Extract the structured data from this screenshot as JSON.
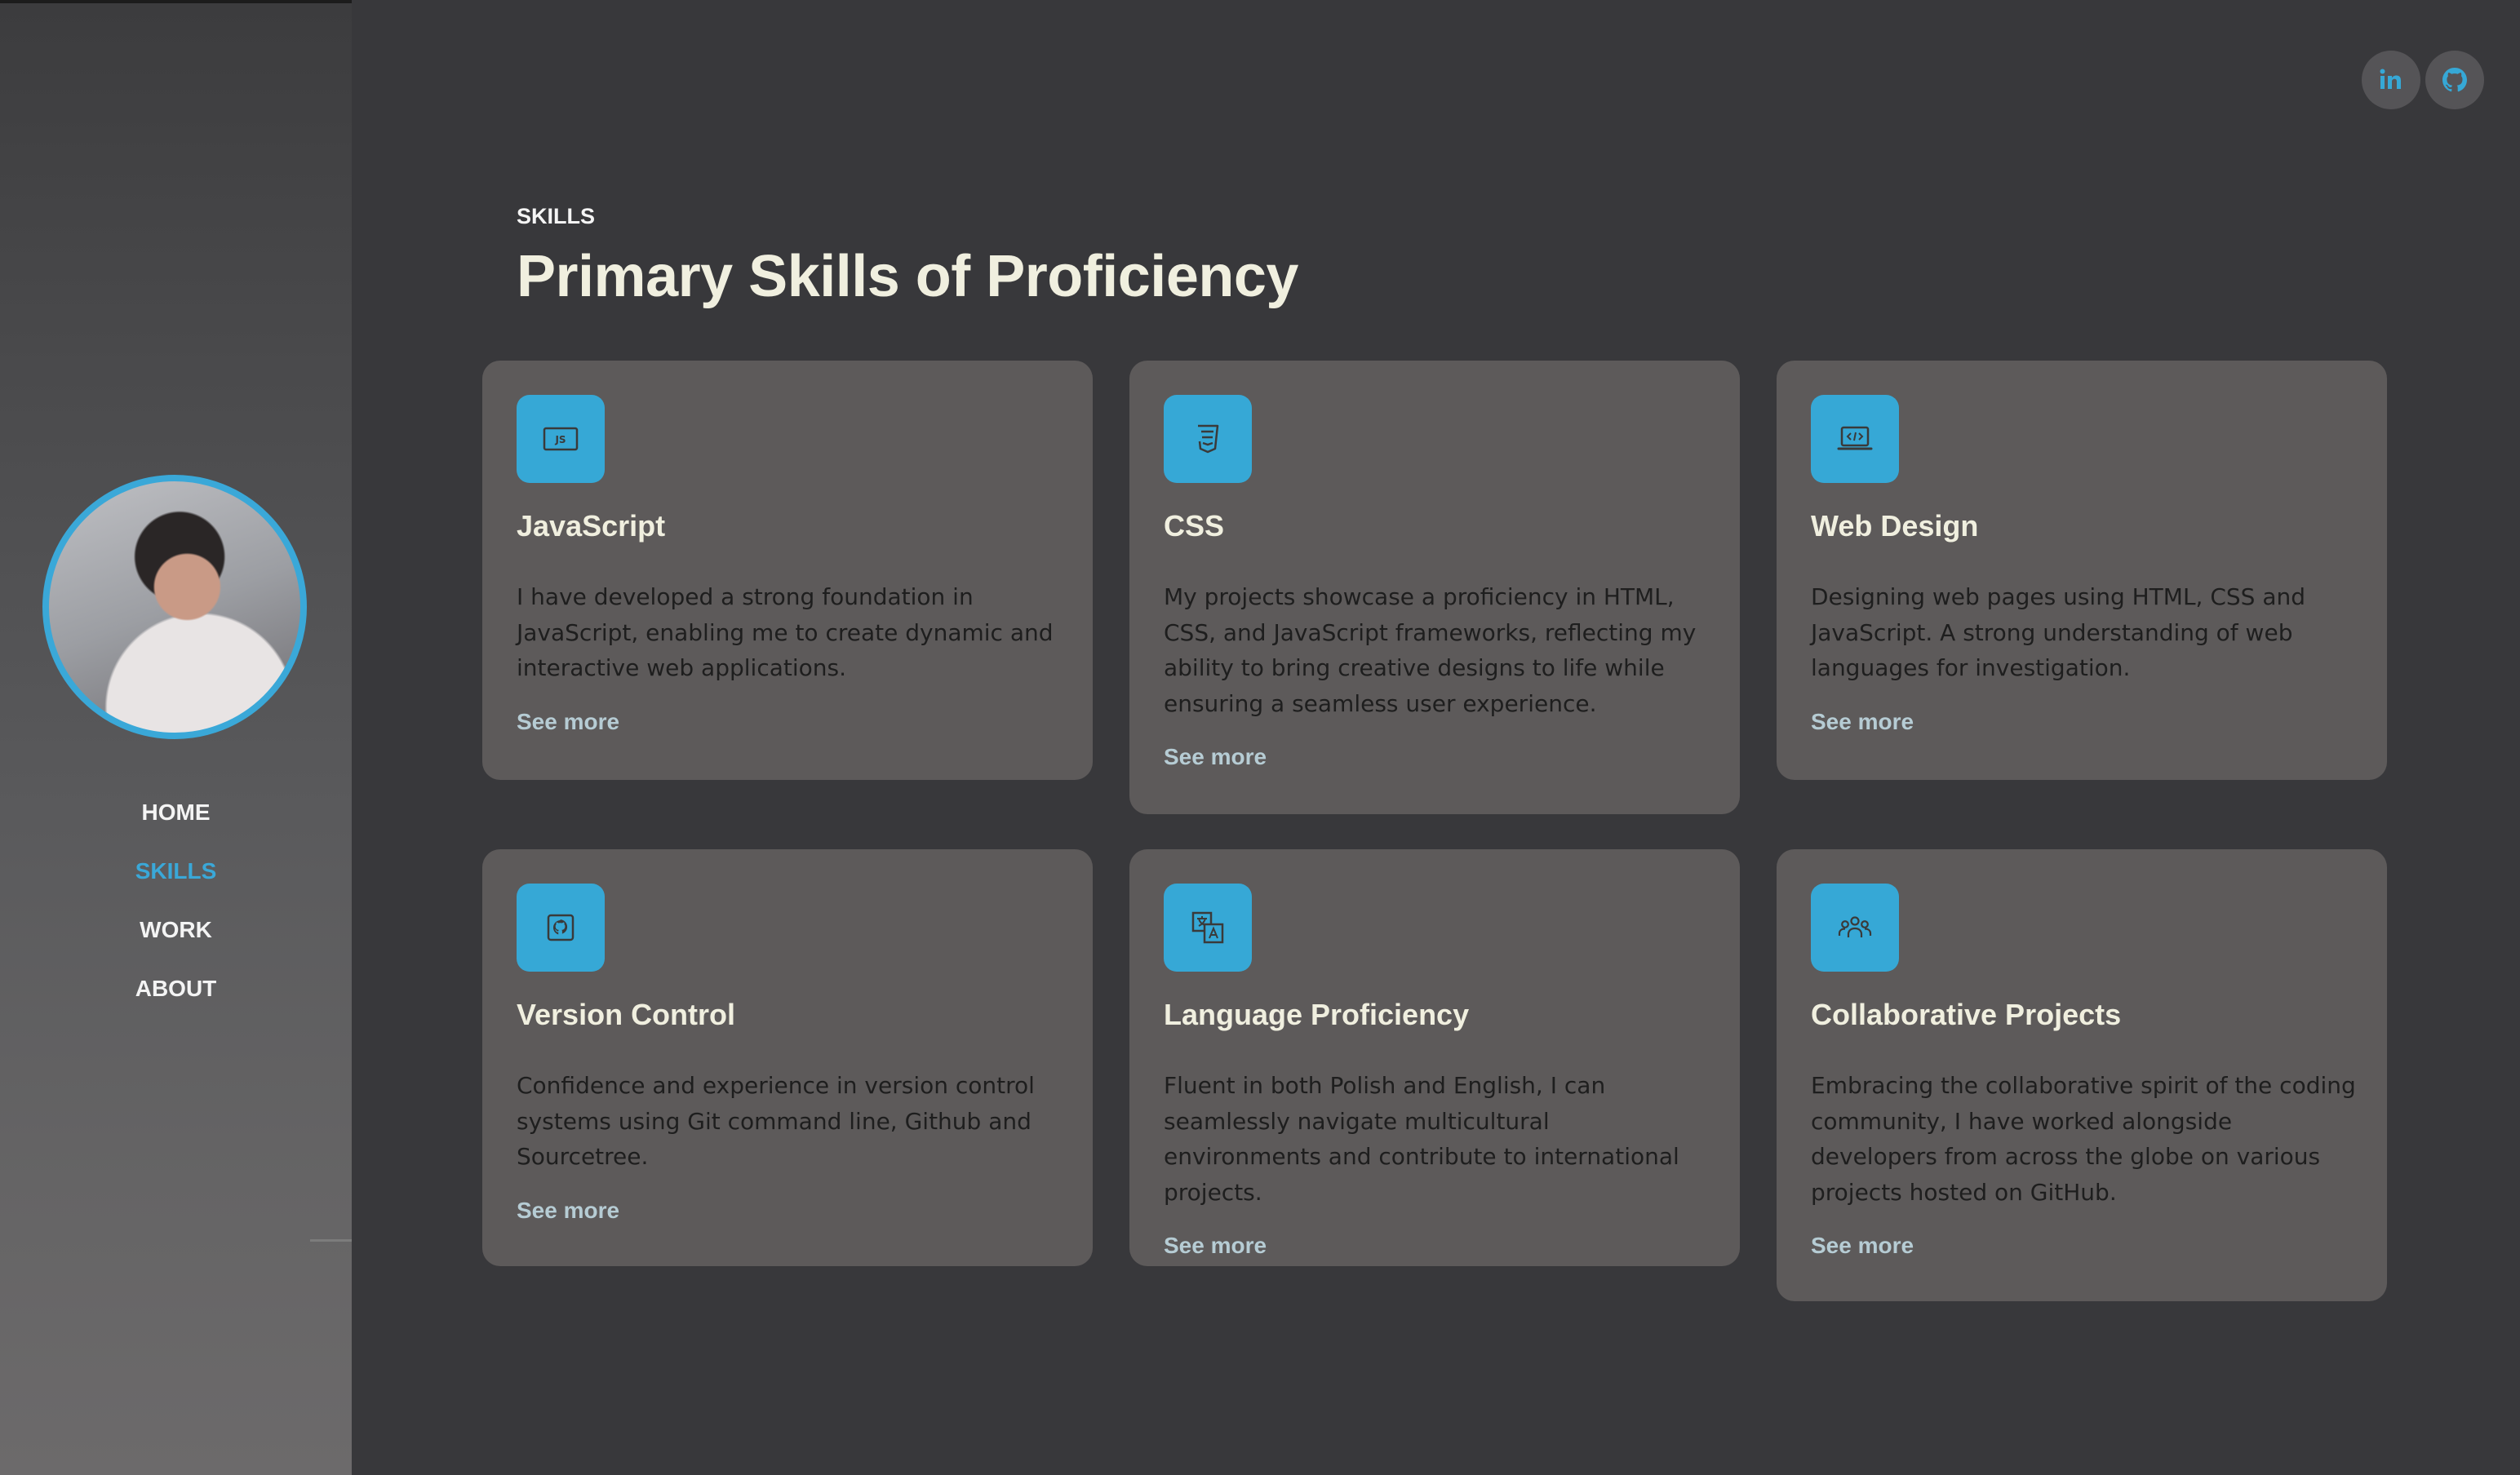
{
  "nav": {
    "items": [
      {
        "label": "HOME",
        "active": false
      },
      {
        "label": "SKILLS",
        "active": true
      },
      {
        "label": "WORK",
        "active": false
      },
      {
        "label": "ABOUT",
        "active": false
      }
    ]
  },
  "social": [
    {
      "icon": "linkedin-icon"
    },
    {
      "icon": "github-icon"
    }
  ],
  "section": {
    "eyebrow": "SKILLS",
    "title": "Primary Skills of Proficiency"
  },
  "colors": {
    "accent": "#36a8d6",
    "background": "#38383b",
    "card": "#5d5a5a",
    "title_text": "#f0efdf"
  },
  "cards": [
    {
      "icon": "javascript-icon",
      "title": "JavaScript",
      "text": "I have developed a strong foundation in JavaScript, enabling me to create dynamic and interactive web applications.",
      "link": "See more"
    },
    {
      "icon": "css3-icon",
      "title": "CSS",
      "text": "My projects showcase a proficiency in HTML, CSS, and JavaScript frameworks, reflecting my ability to bring creative designs to life while ensuring a seamless user experience.",
      "link": "See more"
    },
    {
      "icon": "laptop-code-icon",
      "title": "Web Design",
      "text": "Designing web pages using HTML, CSS and JavaScript. A strong understanding of web languages for investigation.",
      "link": "See more"
    },
    {
      "icon": "github-box-icon",
      "title": "Version Control",
      "text": "Confidence and experience in version control systems using Git command line, Github and Sourcetree.",
      "link": "See more"
    },
    {
      "icon": "translate-icon",
      "title": "Language Proficiency",
      "text": "Fluent in both Polish and English, I can seamlessly navigate multicultural environments and contribute to international projects.",
      "link": "See more"
    },
    {
      "icon": "team-icon",
      "title": "Collaborative Projects",
      "text": "Embracing the collaborative spirit of the coding community, I have worked alongside developers from across the globe on various projects hosted on GitHub.",
      "link": "See more"
    }
  ]
}
